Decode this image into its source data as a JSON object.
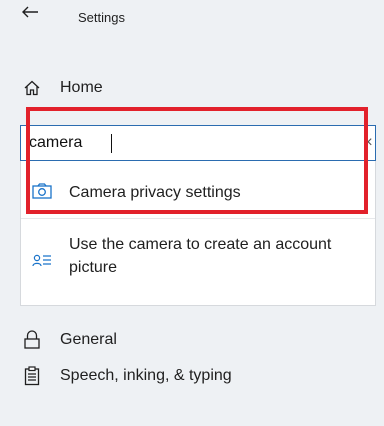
{
  "window": {
    "title": "Settings"
  },
  "nav": {
    "home": {
      "label": "Home",
      "icon": "home-icon"
    },
    "general": {
      "label": "General",
      "icon": "lock-icon"
    },
    "speech": {
      "label": "Speech, inking, & typing",
      "icon": "clipboard-icon"
    }
  },
  "search": {
    "value": "camera",
    "clear_glyph": "×"
  },
  "results": [
    {
      "label": "Camera privacy settings",
      "icon": "camera-icon"
    },
    {
      "label": "Use the camera to create an account picture",
      "icon": "account-picture-icon"
    }
  ],
  "colors": {
    "accent": "#2b6cb0",
    "highlight": "#e2212b",
    "background": "#eef1f4",
    "icon_blue": "#1a73c9"
  }
}
